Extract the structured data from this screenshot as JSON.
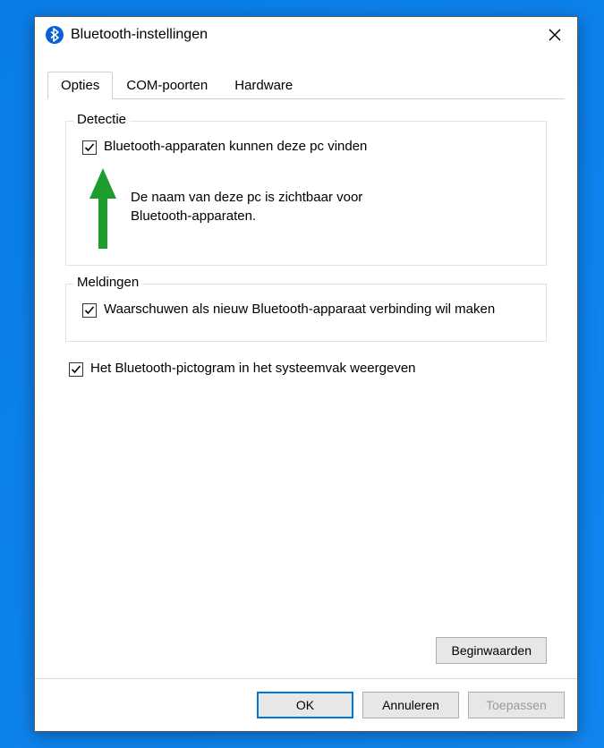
{
  "window": {
    "title": "Bluetooth-instellingen"
  },
  "tabs": [
    {
      "label": "Opties",
      "active": true
    },
    {
      "label": "COM-poorten",
      "active": false
    },
    {
      "label": "Hardware",
      "active": false
    }
  ],
  "group_detection": {
    "legend": "Detectie",
    "checkbox_label": "Bluetooth-apparaten kunnen deze pc vinden",
    "checkbox_checked": true,
    "description": "De naam van deze pc is zichtbaar voor Bluetooth-apparaten."
  },
  "group_notifications": {
    "legend": "Meldingen",
    "checkbox_label": "Waarschuwen als nieuw Bluetooth-apparaat verbinding wil maken",
    "checkbox_checked": true
  },
  "tray_icon": {
    "checkbox_label": "Het Bluetooth-pictogram in het systeemvak weergeven",
    "checkbox_checked": true
  },
  "buttons": {
    "defaults": "Beginwaarden",
    "ok": "OK",
    "cancel": "Annuleren",
    "apply": "Toepassen"
  },
  "annotation": {
    "arrow_color": "#1e9c2e"
  }
}
